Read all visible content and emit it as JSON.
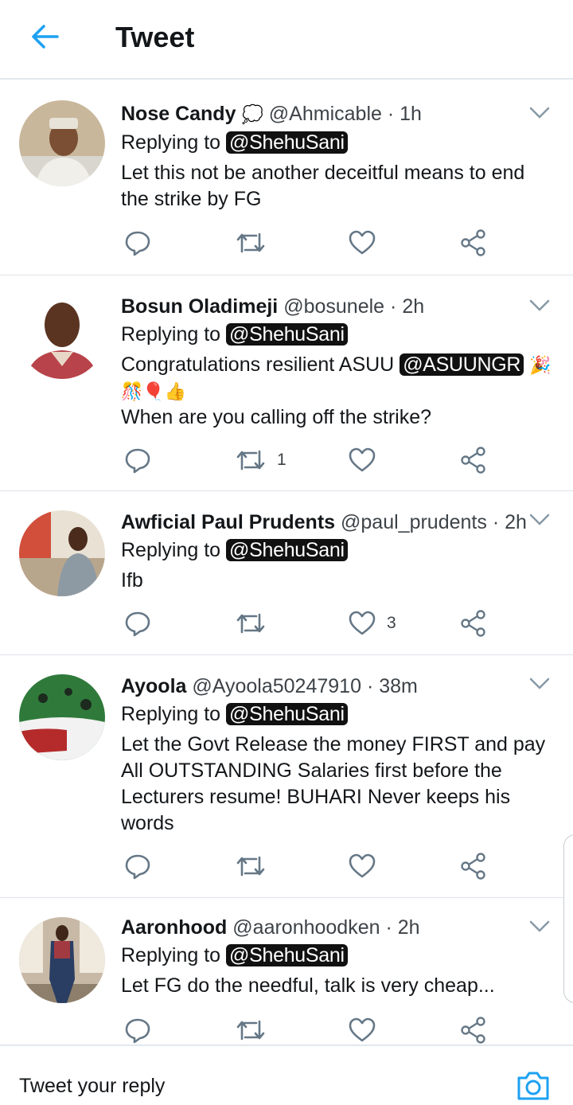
{
  "header": {
    "title": "Tweet",
    "back_icon": "arrow-left-icon"
  },
  "colors": {
    "accent": "#1da1f2",
    "icon_gray": "#657786",
    "divider": "#e1e8ed"
  },
  "tweets": [
    {
      "name": "Nose Candy",
      "name_emoji": "💭",
      "handle": "@Ahmicable",
      "sep": "·",
      "time": "1h",
      "replying_label": "Replying to",
      "replying_to": "@ShehuSani",
      "text_lines": [
        "Let this not be another deceitful means to end",
        "the strike by FG"
      ],
      "retweets": "",
      "likes": ""
    },
    {
      "name": "Bosun Oladimeji",
      "handle": "@bosunele",
      "sep": "·",
      "time": "2h",
      "replying_label": "Replying to",
      "replying_to": "@ShehuSani",
      "text_prefix": "Congratulations resilient ASUU",
      "text_mention": "@ASUUNGR",
      "emoji_1": "🎉",
      "emoji_line": "🎊🎈👍",
      "text_line_3": "When are you calling off the strike?",
      "retweets": "1",
      "likes": ""
    },
    {
      "name": "Awficial Paul Prudents",
      "handle": "@paul_prudents",
      "sep": "·",
      "time": "2h",
      "replying_label": "Replying to",
      "replying_to": "@ShehuSani",
      "text_lines": [
        "Ifb"
      ],
      "retweets": "",
      "likes": "3"
    },
    {
      "name": "Ayoola",
      "handle": "@Ayoola50247910",
      "sep": "·",
      "time": "38m",
      "replying_label": "Replying to",
      "replying_to": "@ShehuSani",
      "text_lines": [
        "Let the Govt Release the money FIRST and pay",
        "All OUTSTANDING Salaries first before the",
        "Lecturers resume! BUHARI Never keeps his",
        "words"
      ],
      "retweets": "",
      "likes": ""
    },
    {
      "name": "Aaronhood",
      "handle": "@aaronhoodken",
      "sep": "·",
      "time": "2h",
      "replying_label": "Replying to",
      "replying_to": "@ShehuSani",
      "text_lines": [
        "Let FG do the needful, talk is very cheap..."
      ],
      "retweets": "",
      "likes": ""
    }
  ],
  "action_icons": [
    "reply-icon",
    "retweet-icon",
    "like-icon",
    "share-icon"
  ],
  "reply_bar": {
    "placeholder": "Tweet your reply",
    "camera_icon": "camera-icon"
  }
}
